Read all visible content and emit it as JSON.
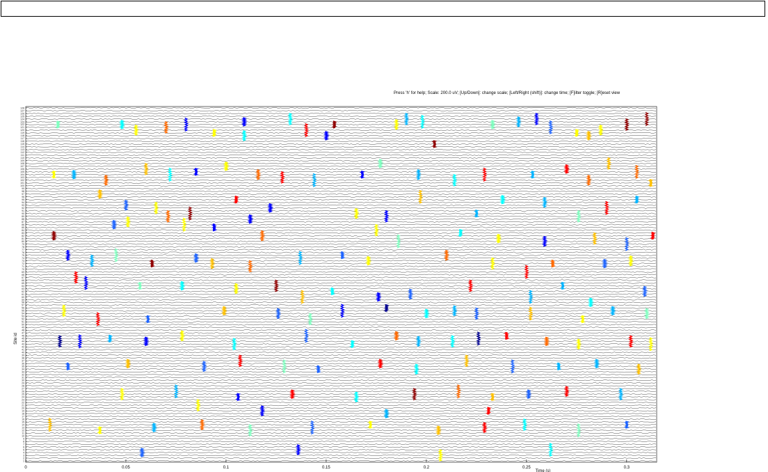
{
  "command_input": {
    "value": ""
  },
  "help_text": "Press 'h' for help; Scale: 200.0 uV; [Up/Down]: change scale; [Left/Right (shift)]: change time; [F]ilter toggle; [R]eset view",
  "chart_data": {
    "type": "line",
    "subtype": "multichannel-voltage-traces-with-colored-spike-overlays",
    "title": "",
    "xlabel": "Time (s)",
    "ylabel": "Site id",
    "xlim": [
      0,
      0.315
    ],
    "x_ticks": [
      0,
      0.05,
      0.1,
      0.15,
      0.2,
      0.25,
      0.3
    ],
    "x_tick_labels": [
      "0",
      "0.05",
      "0.1",
      "0.15",
      "0.2",
      "0.25",
      "0.3"
    ],
    "n_sites": 128,
    "scale_uV": 200.0,
    "grid": false,
    "legend": "none",
    "trace_color": "#000000",
    "spike_colormap": [
      "#00008f",
      "#0000ff",
      "#1e64ff",
      "#00b4ff",
      "#00ffff",
      "#7fffbf",
      "#ffff00",
      "#ffc000",
      "#ff6a00",
      "#ff0000",
      "#8f0000"
    ],
    "spikes": [
      {
        "t": 0.016,
        "site": 122,
        "c": 5
      },
      {
        "t": 0.048,
        "site": 122,
        "c": 4
      },
      {
        "t": 0.055,
        "site": 120,
        "c": 6
      },
      {
        "t": 0.07,
        "site": 121,
        "c": 8
      },
      {
        "t": 0.08,
        "site": 122,
        "c": 1
      },
      {
        "t": 0.094,
        "site": 119,
        "c": 6
      },
      {
        "t": 0.109,
        "site": 123,
        "c": 1
      },
      {
        "t": 0.109,
        "site": 118,
        "c": 4
      },
      {
        "t": 0.132,
        "site": 124,
        "c": 4
      },
      {
        "t": 0.14,
        "site": 120,
        "c": 9
      },
      {
        "t": 0.154,
        "site": 122,
        "c": 10
      },
      {
        "t": 0.15,
        "site": 118,
        "c": 1
      },
      {
        "t": 0.185,
        "site": 122,
        "c": 6
      },
      {
        "t": 0.19,
        "site": 124,
        "c": 3
      },
      {
        "t": 0.198,
        "site": 123,
        "c": 4
      },
      {
        "t": 0.204,
        "site": 115,
        "c": 10
      },
      {
        "t": 0.233,
        "site": 122,
        "c": 5
      },
      {
        "t": 0.246,
        "site": 123,
        "c": 3
      },
      {
        "t": 0.255,
        "site": 124,
        "c": 1
      },
      {
        "t": 0.262,
        "site": 121,
        "c": 2
      },
      {
        "t": 0.275,
        "site": 119,
        "c": 6
      },
      {
        "t": 0.281,
        "site": 118,
        "c": 7
      },
      {
        "t": 0.287,
        "site": 120,
        "c": 6
      },
      {
        "t": 0.3,
        "site": 122,
        "c": 10
      },
      {
        "t": 0.31,
        "site": 124,
        "c": 10
      },
      {
        "t": 0.014,
        "site": 104,
        "c": 6
      },
      {
        "t": 0.024,
        "site": 104,
        "c": 3
      },
      {
        "t": 0.04,
        "site": 102,
        "c": 8
      },
      {
        "t": 0.06,
        "site": 106,
        "c": 7
      },
      {
        "t": 0.072,
        "site": 104,
        "c": 4
      },
      {
        "t": 0.085,
        "site": 105,
        "c": 1
      },
      {
        "t": 0.1,
        "site": 107,
        "c": 6
      },
      {
        "t": 0.116,
        "site": 104,
        "c": 8
      },
      {
        "t": 0.128,
        "site": 103,
        "c": 9
      },
      {
        "t": 0.144,
        "site": 102,
        "c": 3
      },
      {
        "t": 0.168,
        "site": 104,
        "c": 1
      },
      {
        "t": 0.177,
        "site": 108,
        "c": 5
      },
      {
        "t": 0.196,
        "site": 104,
        "c": 3
      },
      {
        "t": 0.214,
        "site": 102,
        "c": 4
      },
      {
        "t": 0.229,
        "site": 104,
        "c": 9
      },
      {
        "t": 0.253,
        "site": 104,
        "c": 3
      },
      {
        "t": 0.27,
        "site": 106,
        "c": 9
      },
      {
        "t": 0.281,
        "site": 102,
        "c": 8
      },
      {
        "t": 0.291,
        "site": 108,
        "c": 7
      },
      {
        "t": 0.305,
        "site": 105,
        "c": 8
      },
      {
        "t": 0.312,
        "site": 101,
        "c": 7
      },
      {
        "t": 0.037,
        "site": 97,
        "c": 7
      },
      {
        "t": 0.05,
        "site": 93,
        "c": 2
      },
      {
        "t": 0.065,
        "site": 92,
        "c": 6
      },
      {
        "t": 0.082,
        "site": 90,
        "c": 10
      },
      {
        "t": 0.105,
        "site": 95,
        "c": 9
      },
      {
        "t": 0.122,
        "site": 92,
        "c": 1
      },
      {
        "t": 0.165,
        "site": 90,
        "c": 6
      },
      {
        "t": 0.18,
        "site": 89,
        "c": 1
      },
      {
        "t": 0.197,
        "site": 96,
        "c": 7
      },
      {
        "t": 0.225,
        "site": 90,
        "c": 3
      },
      {
        "t": 0.238,
        "site": 95,
        "c": 4
      },
      {
        "t": 0.259,
        "site": 94,
        "c": 3
      },
      {
        "t": 0.276,
        "site": 89,
        "c": 5
      },
      {
        "t": 0.29,
        "site": 92,
        "c": 9
      },
      {
        "t": 0.305,
        "site": 95,
        "c": 3
      },
      {
        "t": 0.044,
        "site": 86,
        "c": 2
      },
      {
        "t": 0.051,
        "site": 87,
        "c": 6
      },
      {
        "t": 0.071,
        "site": 89,
        "c": 8
      },
      {
        "t": 0.079,
        "site": 86,
        "c": 6
      },
      {
        "t": 0.094,
        "site": 85,
        "c": 1
      },
      {
        "t": 0.112,
        "site": 88,
        "c": 1
      },
      {
        "t": 0.118,
        "site": 82,
        "c": 8
      },
      {
        "t": 0.175,
        "site": 84,
        "c": 6
      },
      {
        "t": 0.186,
        "site": 80,
        "c": 5
      },
      {
        "t": 0.217,
        "site": 83,
        "c": 4
      },
      {
        "t": 0.236,
        "site": 81,
        "c": 6
      },
      {
        "t": 0.259,
        "site": 80,
        "c": 1
      },
      {
        "t": 0.284,
        "site": 81,
        "c": 7
      },
      {
        "t": 0.3,
        "site": 79,
        "c": 2
      },
      {
        "t": 0.313,
        "site": 82,
        "c": 9
      },
      {
        "t": 0.014,
        "site": 82,
        "c": 10
      },
      {
        "t": 0.021,
        "site": 75,
        "c": 1
      },
      {
        "t": 0.033,
        "site": 73,
        "c": 3
      },
      {
        "t": 0.045,
        "site": 75,
        "c": 5
      },
      {
        "t": 0.063,
        "site": 72,
        "c": 10
      },
      {
        "t": 0.085,
        "site": 74,
        "c": 2
      },
      {
        "t": 0.093,
        "site": 72,
        "c": 7
      },
      {
        "t": 0.112,
        "site": 71,
        "c": 8
      },
      {
        "t": 0.137,
        "site": 74,
        "c": 3
      },
      {
        "t": 0.158,
        "site": 75,
        "c": 2
      },
      {
        "t": 0.171,
        "site": 73,
        "c": 6
      },
      {
        "t": 0.21,
        "site": 75,
        "c": 8
      },
      {
        "t": 0.233,
        "site": 72,
        "c": 6
      },
      {
        "t": 0.25,
        "site": 69,
        "c": 9
      },
      {
        "t": 0.263,
        "site": 72,
        "c": 8
      },
      {
        "t": 0.289,
        "site": 72,
        "c": 2
      },
      {
        "t": 0.302,
        "site": 73,
        "c": 6
      },
      {
        "t": 0.025,
        "site": 67,
        "c": 9
      },
      {
        "t": 0.03,
        "site": 65,
        "c": 1
      },
      {
        "t": 0.057,
        "site": 64,
        "c": 5
      },
      {
        "t": 0.078,
        "site": 64,
        "c": 4
      },
      {
        "t": 0.105,
        "site": 63,
        "c": 6
      },
      {
        "t": 0.125,
        "site": 64,
        "c": 10
      },
      {
        "t": 0.138,
        "site": 60,
        "c": 7
      },
      {
        "t": 0.153,
        "site": 62,
        "c": 4
      },
      {
        "t": 0.176,
        "site": 60,
        "c": 1
      },
      {
        "t": 0.192,
        "site": 61,
        "c": 2
      },
      {
        "t": 0.222,
        "site": 64,
        "c": 9
      },
      {
        "t": 0.252,
        "site": 60,
        "c": 3
      },
      {
        "t": 0.268,
        "site": 64,
        "c": 3
      },
      {
        "t": 0.282,
        "site": 58,
        "c": 4
      },
      {
        "t": 0.309,
        "site": 62,
        "c": 2
      },
      {
        "t": 0.019,
        "site": 55,
        "c": 6
      },
      {
        "t": 0.036,
        "site": 52,
        "c": 9
      },
      {
        "t": 0.061,
        "site": 52,
        "c": 2
      },
      {
        "t": 0.099,
        "site": 55,
        "c": 7
      },
      {
        "t": 0.126,
        "site": 54,
        "c": 2
      },
      {
        "t": 0.142,
        "site": 52,
        "c": 5
      },
      {
        "t": 0.158,
        "site": 55,
        "c": 1
      },
      {
        "t": 0.18,
        "site": 56,
        "c": 0
      },
      {
        "t": 0.2,
        "site": 54,
        "c": 4
      },
      {
        "t": 0.214,
        "site": 55,
        "c": 3
      },
      {
        "t": 0.225,
        "site": 54,
        "c": 2
      },
      {
        "t": 0.252,
        "site": 54,
        "c": 7
      },
      {
        "t": 0.278,
        "site": 52,
        "c": 6
      },
      {
        "t": 0.293,
        "site": 55,
        "c": 3
      },
      {
        "t": 0.31,
        "site": 54,
        "c": 5
      },
      {
        "t": 0.017,
        "site": 44,
        "c": 0
      },
      {
        "t": 0.027,
        "site": 44,
        "c": 1
      },
      {
        "t": 0.042,
        "site": 45,
        "c": 3
      },
      {
        "t": 0.06,
        "site": 44,
        "c": 1
      },
      {
        "t": 0.078,
        "site": 46,
        "c": 6
      },
      {
        "t": 0.104,
        "site": 43,
        "c": 4
      },
      {
        "t": 0.14,
        "site": 46,
        "c": 2
      },
      {
        "t": 0.163,
        "site": 43,
        "c": 4
      },
      {
        "t": 0.185,
        "site": 46,
        "c": 8
      },
      {
        "t": 0.196,
        "site": 44,
        "c": 3
      },
      {
        "t": 0.213,
        "site": 44,
        "c": 4
      },
      {
        "t": 0.226,
        "site": 45,
        "c": 0
      },
      {
        "t": 0.24,
        "site": 46,
        "c": 9
      },
      {
        "t": 0.26,
        "site": 44,
        "c": 8
      },
      {
        "t": 0.276,
        "site": 43,
        "c": 6
      },
      {
        "t": 0.302,
        "site": 44,
        "c": 9
      },
      {
        "t": 0.312,
        "site": 43,
        "c": 6
      },
      {
        "t": 0.021,
        "site": 35,
        "c": 2
      },
      {
        "t": 0.051,
        "site": 36,
        "c": 7
      },
      {
        "t": 0.089,
        "site": 35,
        "c": 2
      },
      {
        "t": 0.107,
        "site": 37,
        "c": 9
      },
      {
        "t": 0.129,
        "site": 35,
        "c": 5
      },
      {
        "t": 0.146,
        "site": 34,
        "c": 2
      },
      {
        "t": 0.177,
        "site": 36,
        "c": 9
      },
      {
        "t": 0.195,
        "site": 34,
        "c": 4
      },
      {
        "t": 0.22,
        "site": 37,
        "c": 7
      },
      {
        "t": 0.243,
        "site": 35,
        "c": 2
      },
      {
        "t": 0.266,
        "site": 35,
        "c": 3
      },
      {
        "t": 0.285,
        "site": 36,
        "c": 3
      },
      {
        "t": 0.306,
        "site": 34,
        "c": 7
      },
      {
        "t": 0.048,
        "site": 25,
        "c": 6
      },
      {
        "t": 0.075,
        "site": 26,
        "c": 3
      },
      {
        "t": 0.106,
        "site": 24,
        "c": 1
      },
      {
        "t": 0.133,
        "site": 25,
        "c": 9
      },
      {
        "t": 0.165,
        "site": 24,
        "c": 4
      },
      {
        "t": 0.194,
        "site": 25,
        "c": 10
      },
      {
        "t": 0.216,
        "site": 26,
        "c": 8
      },
      {
        "t": 0.233,
        "site": 24,
        "c": 7
      },
      {
        "t": 0.251,
        "site": 25,
        "c": 2
      },
      {
        "t": 0.27,
        "site": 26,
        "c": 9
      },
      {
        "t": 0.297,
        "site": 25,
        "c": 3
      },
      {
        "t": 0.012,
        "site": 14,
        "c": 7
      },
      {
        "t": 0.037,
        "site": 12,
        "c": 6
      },
      {
        "t": 0.064,
        "site": 13,
        "c": 3
      },
      {
        "t": 0.088,
        "site": 14,
        "c": 8
      },
      {
        "t": 0.112,
        "site": 12,
        "c": 5
      },
      {
        "t": 0.143,
        "site": 13,
        "c": 2
      },
      {
        "t": 0.172,
        "site": 14,
        "c": 6
      },
      {
        "t": 0.206,
        "site": 12,
        "c": 7
      },
      {
        "t": 0.229,
        "site": 13,
        "c": 9
      },
      {
        "t": 0.249,
        "site": 14,
        "c": 4
      },
      {
        "t": 0.276,
        "site": 12,
        "c": 5
      },
      {
        "t": 0.3,
        "site": 14,
        "c": 2
      },
      {
        "t": 0.058,
        "site": 4,
        "c": 2
      },
      {
        "t": 0.136,
        "site": 5,
        "c": 1
      },
      {
        "t": 0.207,
        "site": 3,
        "c": 6
      },
      {
        "t": 0.262,
        "site": 5,
        "c": 4
      },
      {
        "t": 0.231,
        "site": 19,
        "c": 9
      },
      {
        "t": 0.18,
        "site": 18,
        "c": 3
      },
      {
        "t": 0.118,
        "site": 19,
        "c": 1
      },
      {
        "t": 0.086,
        "site": 21,
        "c": 6
      }
    ]
  }
}
